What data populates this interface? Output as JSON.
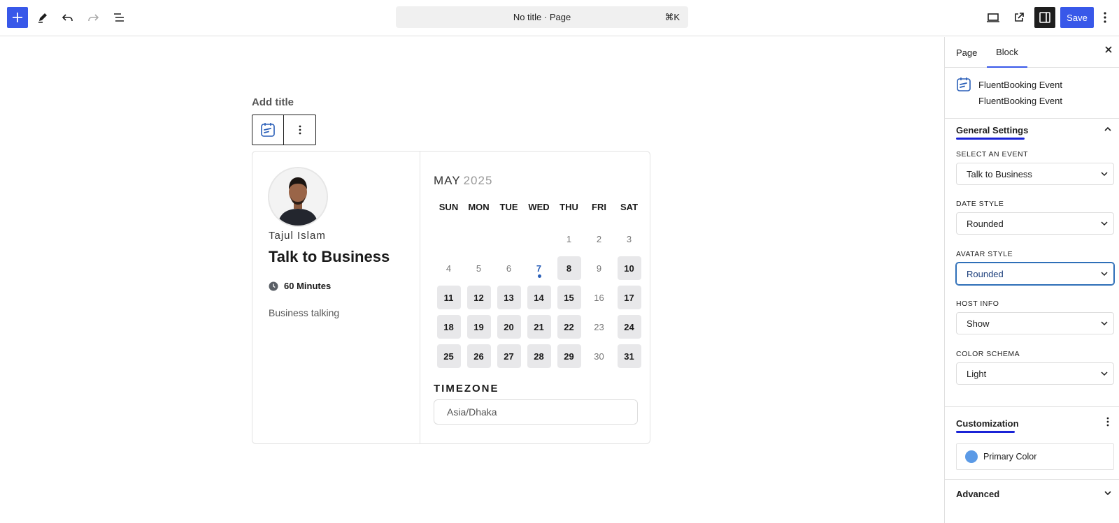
{
  "topbar": {
    "command_bar_text": "No title · Page",
    "command_shortcut": "⌘K",
    "save_label": "Save"
  },
  "editor": {
    "title_placeholder": "Add title"
  },
  "booking": {
    "host_name": "Tajul Islam",
    "event_title": "Talk to Business",
    "duration": "60 Minutes",
    "description": "Business talking",
    "month": "MAY",
    "year": "2025",
    "weekdays": [
      "SUN",
      "MON",
      "TUE",
      "WED",
      "THU",
      "FRI",
      "SAT"
    ],
    "days": [
      {
        "n": "",
        "state": "empty"
      },
      {
        "n": "",
        "state": "empty"
      },
      {
        "n": "",
        "state": "empty"
      },
      {
        "n": "",
        "state": "empty"
      },
      {
        "n": "1",
        "state": "off"
      },
      {
        "n": "2",
        "state": "off"
      },
      {
        "n": "3",
        "state": "off"
      },
      {
        "n": "4",
        "state": "off"
      },
      {
        "n": "5",
        "state": "off"
      },
      {
        "n": "6",
        "state": "off"
      },
      {
        "n": "7",
        "state": "today"
      },
      {
        "n": "8",
        "state": "avail"
      },
      {
        "n": "9",
        "state": "off"
      },
      {
        "n": "10",
        "state": "avail"
      },
      {
        "n": "11",
        "state": "avail"
      },
      {
        "n": "12",
        "state": "avail"
      },
      {
        "n": "13",
        "state": "avail"
      },
      {
        "n": "14",
        "state": "avail"
      },
      {
        "n": "15",
        "state": "avail"
      },
      {
        "n": "16",
        "state": "off"
      },
      {
        "n": "17",
        "state": "avail"
      },
      {
        "n": "18",
        "state": "avail"
      },
      {
        "n": "19",
        "state": "avail"
      },
      {
        "n": "20",
        "state": "avail"
      },
      {
        "n": "21",
        "state": "avail"
      },
      {
        "n": "22",
        "state": "avail"
      },
      {
        "n": "23",
        "state": "off"
      },
      {
        "n": "24",
        "state": "avail"
      },
      {
        "n": "25",
        "state": "avail"
      },
      {
        "n": "26",
        "state": "avail"
      },
      {
        "n": "27",
        "state": "avail"
      },
      {
        "n": "28",
        "state": "avail"
      },
      {
        "n": "29",
        "state": "avail"
      },
      {
        "n": "30",
        "state": "off"
      },
      {
        "n": "31",
        "state": "avail"
      }
    ],
    "timezone_label": "TIMEZONE",
    "timezone_value": "Asia/Dhaka"
  },
  "sidebar": {
    "tab_page": "Page",
    "tab_block": "Block",
    "block_name": "FluentBooking Event",
    "block_description": "FluentBooking Event",
    "general_settings": "General Settings",
    "fields": [
      {
        "label": "SELECT AN EVENT",
        "value": "Talk to Business"
      },
      {
        "label": "DATE STYLE",
        "value": "Rounded"
      },
      {
        "label": "AVATAR STYLE",
        "value": "Rounded"
      },
      {
        "label": "HOST INFO",
        "value": "Show"
      },
      {
        "label": "COLOR SCHEMA",
        "value": "Light"
      }
    ],
    "customization": "Customization",
    "primary_color_label": "Primary Color",
    "primary_color": "#5b9ae6",
    "advanced": "Advanced"
  },
  "colors": {
    "accent": "#3858e9",
    "annotation_underline": "#1a23d6"
  }
}
